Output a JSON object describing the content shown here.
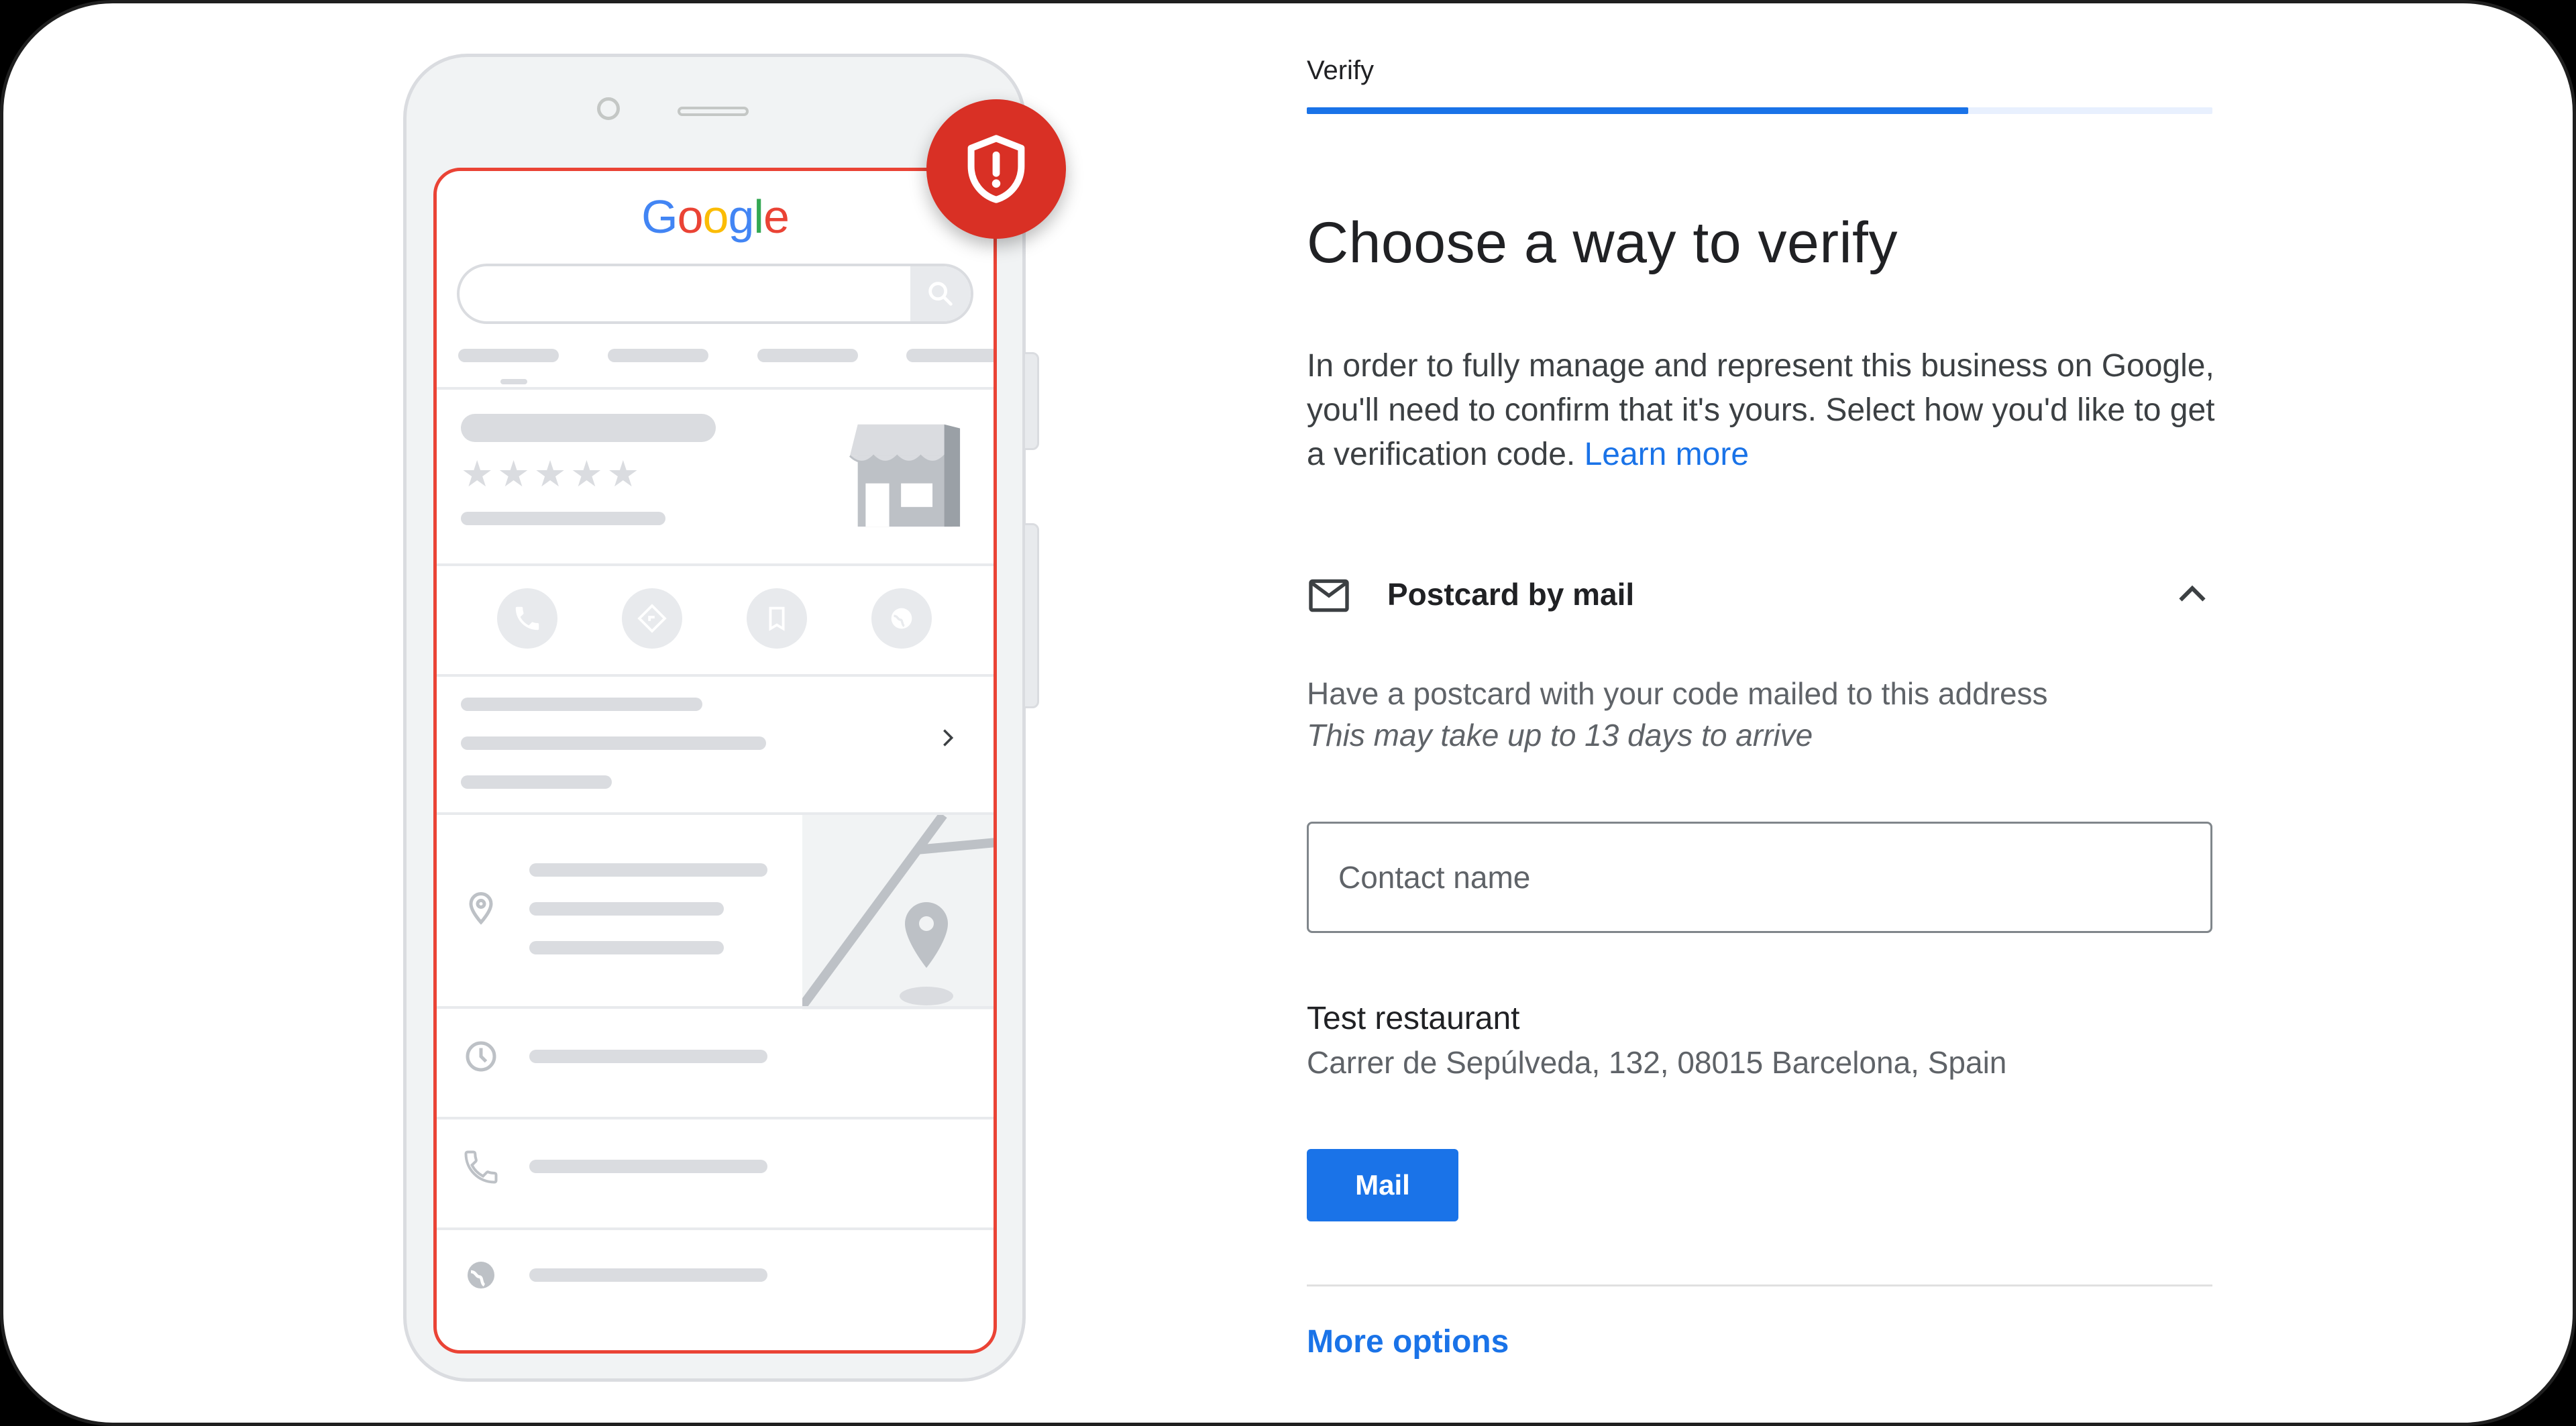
{
  "illustration": {
    "logo_letters": [
      "G",
      "o",
      "o",
      "g",
      "l",
      "e"
    ],
    "rating_stars": "★★★★★",
    "icons": [
      "search-icon",
      "store-icon",
      "phone-icon",
      "directions-icon",
      "bookmark-icon",
      "globe-icon",
      "chevron-right-icon",
      "location-pin-icon",
      "clock-icon",
      "shield-alert-icon"
    ]
  },
  "verify": {
    "step_label": "Verify",
    "progress_fraction": 0.73,
    "title": "Choose a way to verify",
    "description": "In order to fully manage and represent this business on Google, you'll need to confirm that it's yours. Select how you'd like to get a verification code.",
    "learn_more": "Learn more",
    "option": {
      "title": "Postcard by mail",
      "description": "Have a postcard with your code mailed to this address",
      "note": "This may take up to 13 days to arrive",
      "contact_placeholder": "Contact name",
      "business_name": "Test restaurant",
      "business_address": "Carrer de Sepúlveda, 132, 08015 Barcelona, Spain",
      "mail_button": "Mail"
    },
    "more_options": "More options"
  },
  "colors": {
    "accent": "#1a73e8",
    "alert": "#d93025",
    "screen_outline": "#ea4335"
  }
}
